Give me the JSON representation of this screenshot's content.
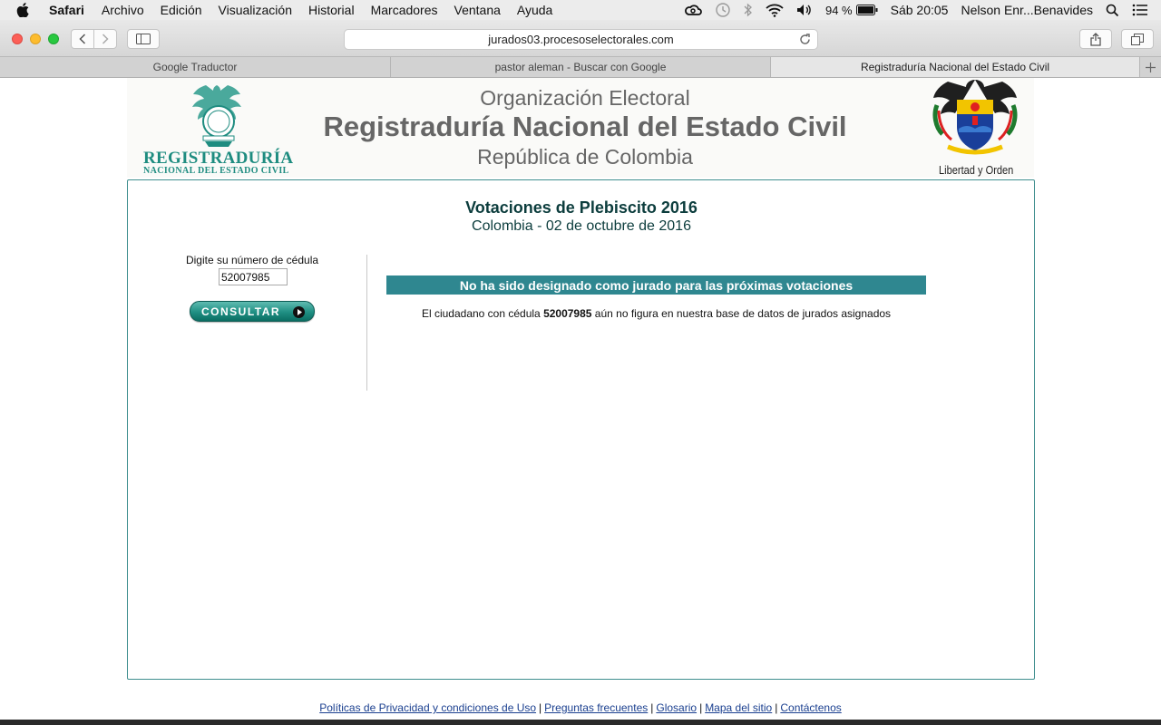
{
  "menubar": {
    "app_name": "Safari",
    "items": [
      "Archivo",
      "Edición",
      "Visualización",
      "Historial",
      "Marcadores",
      "Ventana",
      "Ayuda"
    ],
    "battery": "94 %",
    "clock": "Sáb 20:05",
    "user": "Nelson Enr...Benavides"
  },
  "browser": {
    "url": "jurados03.procesoselectorales.com",
    "tabs": [
      "Google Traductor",
      "pastor aleman - Buscar con Google",
      "Registraduría Nacional del Estado Civil"
    ],
    "active_tab": 2
  },
  "header": {
    "line1": "Organización Electoral",
    "line2": "Registraduría Nacional del Estado Civil",
    "line3": "República de Colombia",
    "logo_left_word": "REGISTRADURÍA",
    "logo_left_sub": "NACIONAL DEL ESTADO CIVIL",
    "logo_right_motto": "Libertad y Orden"
  },
  "panel": {
    "title": "Votaciones de Plebiscito 2016",
    "subtitle": "Colombia - 02 de octubre de 2016"
  },
  "form": {
    "label": "Digite su número de cédula",
    "cedula_value": "52007985",
    "button_label": "CONSULTAR"
  },
  "result": {
    "banner": "No ha sido designado como jurado para las próximas votaciones",
    "msg_prefix": "El ciudadano con cédula",
    "msg_cedula": "52007985",
    "msg_suffix": "aún no figura en nuestra base de datos de jurados asignados"
  },
  "footer": {
    "links": [
      "Políticas de Privacidad y condiciones de Uso",
      "Preguntas frecuentes",
      "Glosario",
      "Mapa del sitio",
      "Contáctenos"
    ]
  },
  "colors": {
    "accent_teal": "#2f8790",
    "title_dark": "#0c3d3d",
    "logo_green": "#1e8c80"
  }
}
